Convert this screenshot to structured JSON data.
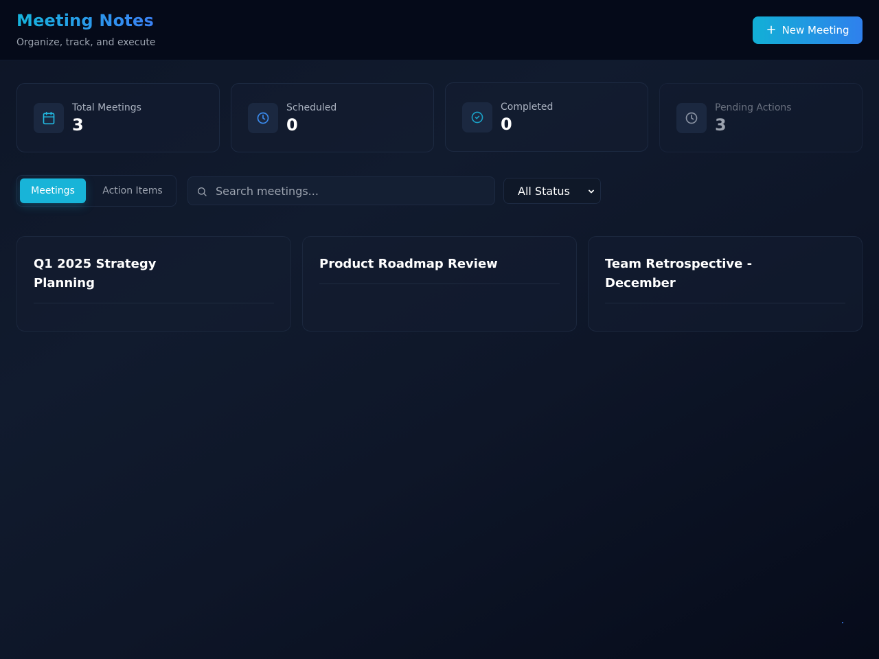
{
  "header": {
    "title": "Meeting Notes",
    "subtitle": "Organize, track, and execute",
    "new_meeting_label": "New Meeting"
  },
  "stats": [
    {
      "label": "Total Meetings",
      "value": "3",
      "icon": "calendar-icon"
    },
    {
      "label": "Scheduled",
      "value": "0",
      "icon": "clock-icon"
    },
    {
      "label": "Completed",
      "value": "0",
      "icon": "check-circle-icon"
    },
    {
      "label": "Pending Actions",
      "value": "3",
      "icon": "clock-icon"
    }
  ],
  "tabs": [
    {
      "label": "Meetings",
      "active": true
    },
    {
      "label": "Action Items",
      "active": false
    }
  ],
  "search": {
    "placeholder": "Search meetings..."
  },
  "status_filter": {
    "selected": "All Status"
  },
  "meetings": [
    {
      "title": "Q1 2025 Strategy Planning"
    },
    {
      "title": "Product Roadmap Review"
    },
    {
      "title": "Team Retrospective - December"
    }
  ],
  "colors": {
    "accent": "#18b4d8",
    "accent_blue": "#2f80ed",
    "background": "#0d1526",
    "card_border": "#1d2a42"
  }
}
